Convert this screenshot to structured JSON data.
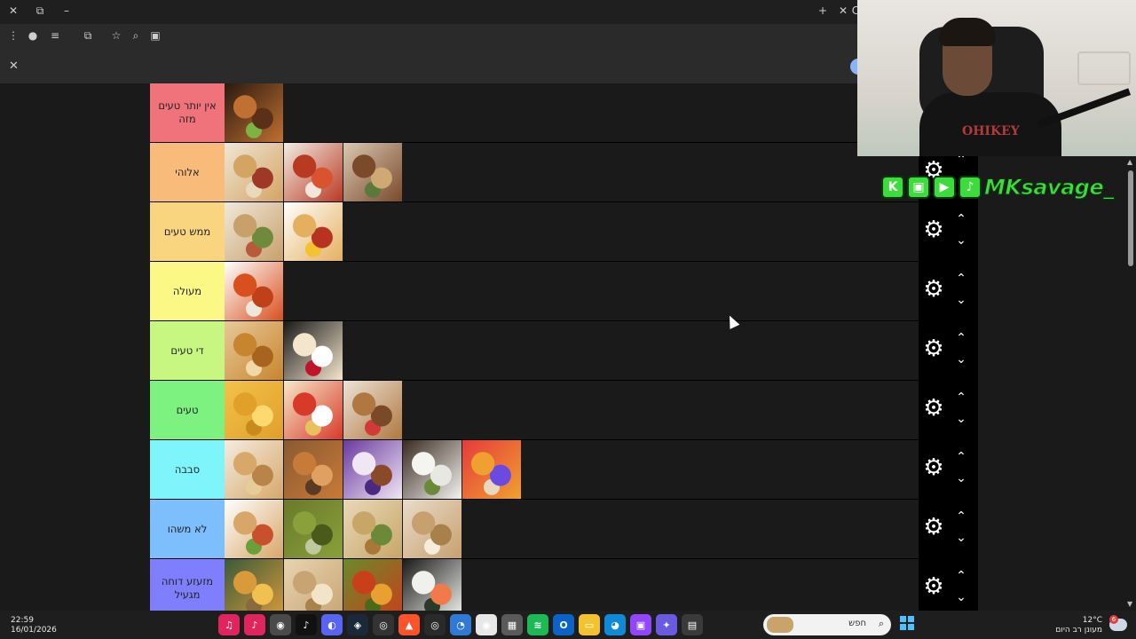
{
  "browser": {
    "titlebar_icons": [
      "close-icon",
      "restore-icon",
      "minimize-icon"
    ],
    "new_tab_label": "+",
    "tab_close_label": "✕",
    "tab_partial_label": "C"
  },
  "toolbar": {
    "icons": [
      "menu-dots-icon",
      "profile-avatar-icon",
      "reading-list-icon",
      "extensions-icon",
      "bookmark-star-icon",
      "zoom-icon",
      "translate-icon"
    ]
  },
  "findbar": {
    "close_label": "✕"
  },
  "tiers": [
    {
      "label": "אין יותר טעים מזה",
      "color": "#f0727b",
      "items": [
        {
          "name": "burger",
          "colors": [
            "#2b1a10",
            "#c07030",
            "#5a3018",
            "#7cb342"
          ]
        }
      ]
    },
    {
      "label": "אלוהי",
      "color": "#f8bb7a",
      "items": [
        {
          "name": "sausage-rolls",
          "colors": [
            "#efe6d6",
            "#d4a462",
            "#a03828",
            "#e8d8bc"
          ]
        },
        {
          "name": "red-pasta",
          "colors": [
            "#f2ece4",
            "#b83a22",
            "#d9542e",
            "#f0e6dc"
          ]
        },
        {
          "name": "pita-sandwich",
          "colors": [
            "#d9c8b2",
            "#7a4a2a",
            "#cfa874",
            "#5a7a3a"
          ]
        }
      ]
    },
    {
      "label": "ממש טעים",
      "color": "#f9d57f",
      "items": [
        {
          "name": "burritos",
          "colors": [
            "#f0e8dc",
            "#c8a06a",
            "#6f8a3a",
            "#b85a3a"
          ]
        },
        {
          "name": "hot-dog",
          "colors": [
            "#ffffff",
            "#e4b060",
            "#b83222",
            "#f2c230"
          ]
        }
      ]
    },
    {
      "label": "מעולה",
      "color": "#fbf886",
      "items": [
        {
          "name": "spaghetti",
          "colors": [
            "#ffffff",
            "#d8501e",
            "#c0401a",
            "#efe7dc"
          ]
        }
      ]
    },
    {
      "label": "די טעים",
      "color": "#c8f781",
      "items": [
        {
          "name": "onion-rings",
          "colors": [
            "#e8c89a",
            "#c7862e",
            "#a8641e",
            "#f0d8a8"
          ]
        },
        {
          "name": "donut",
          "colors": [
            "#1a1a1a",
            "#f4e6cc",
            "#ffffff",
            "#c0142a"
          ]
        }
      ]
    },
    {
      "label": "טעים",
      "color": "#7df281",
      "items": [
        {
          "name": "french-fries",
          "colors": [
            "#f2c24a",
            "#e0a02a",
            "#ffd870",
            "#c88a1a"
          ]
        },
        {
          "name": "popcorn",
          "colors": [
            "#f5e8c8",
            "#d83a2a",
            "#ffffff",
            "#e8c060"
          ]
        },
        {
          "name": "crepes",
          "colors": [
            "#ece3d6",
            "#b07840",
            "#7a4a28",
            "#d23a3a"
          ]
        }
      ]
    },
    {
      "label": "סבבה",
      "color": "#7ef5fa",
      "items": [
        {
          "name": "bourekas",
          "colors": [
            "#f4ece0",
            "#d7a86a",
            "#b88448",
            "#e8cc98"
          ]
        },
        {
          "name": "croissant",
          "colors": [
            "#8a5a32",
            "#c87a38",
            "#e0a060",
            "#5a3a22"
          ]
        },
        {
          "name": "popsicle",
          "colors": [
            "#6a3aa0",
            "#f0e6f4",
            "#8a4a2a",
            "#4a2a80"
          ]
        },
        {
          "name": "rice",
          "colors": [
            "#3a2a20",
            "#f4f4f0",
            "#e8e8e2",
            "#6a8a3a"
          ]
        },
        {
          "name": "rainbow-popsicle",
          "colors": [
            "#e63a3a",
            "#f0a030",
            "#6a4ae0",
            "#e8d8c0"
          ]
        }
      ]
    },
    {
      "label": "לא משהו",
      "color": "#7dbffd",
      "items": [
        {
          "name": "sub-sandwich",
          "colors": [
            "#ffffff",
            "#d8a668",
            "#c8502a",
            "#6aa03a"
          ]
        },
        {
          "name": "pickles",
          "colors": [
            "#6a7a2a",
            "#8aa03a",
            "#4a5a1a",
            "#c0c8a0"
          ]
        },
        {
          "name": "hummus",
          "colors": [
            "#e8d8b8",
            "#c8a668",
            "#6a8a3a",
            "#a87838"
          ]
        },
        {
          "name": "pastry",
          "colors": [
            "#e8dcc8",
            "#c8a070",
            "#a8804a",
            "#f4ecdc"
          ]
        }
      ]
    },
    {
      "label": "מזעזע דוחה מגעיל",
      "color": "#7f7ffd",
      "items": [
        {
          "name": "chickpea-soup",
          "colors": [
            "#3a5a3a",
            "#d89a3a",
            "#f0c050",
            "#8a6a3a"
          ]
        },
        {
          "name": "matzah",
          "colors": [
            "#e8d4b0",
            "#c8a472",
            "#f2e4c8",
            "#a8824a"
          ]
        },
        {
          "name": "olives-salad",
          "colors": [
            "#6a8a2a",
            "#c8401a",
            "#e8a030",
            "#4a6a1a"
          ]
        },
        {
          "name": "sushi",
          "colors": [
            "#1a1a1a",
            "#f0f0ec",
            "#f07a4a",
            "#2a3a2a"
          ]
        }
      ]
    }
  ],
  "controls": {
    "gear_label": "⚙",
    "up_label": "⌃",
    "down_label": "⌄"
  },
  "webcam": {
    "shirt_text": "OHIKEY"
  },
  "social": {
    "handle": "MKsavage_",
    "icons": [
      "kick-icon",
      "twitch-icon",
      "youtube-icon",
      "tiktok-icon"
    ]
  },
  "taskbar": {
    "time": "22:59",
    "date": "16/01/2026",
    "search_placeholder": "חפש",
    "temperature": "12°C",
    "weather_text": "מעונן רב היום",
    "weather_badge": "6",
    "apps": [
      {
        "name": "music-icon",
        "color": "#e0245e",
        "glyph": "♫"
      },
      {
        "name": "tiktok-app-icon",
        "color": "#e0245e",
        "glyph": "♪"
      },
      {
        "name": "chrome-active-icon",
        "color": "#4a4a4a",
        "glyph": "◉"
      },
      {
        "name": "tiktok-icon",
        "color": "#111111",
        "glyph": "♪"
      },
      {
        "name": "discord-icon",
        "color": "#5865f2",
        "glyph": "◐"
      },
      {
        "name": "steam-icon",
        "color": "#1b2838",
        "glyph": "◈"
      },
      {
        "name": "github-icon",
        "color": "#333333",
        "glyph": "◎"
      },
      {
        "name": "brave-icon",
        "color": "#fb542b",
        "glyph": "▲"
      },
      {
        "name": "obs-icon",
        "color": "#2a2a2a",
        "glyph": "◎"
      },
      {
        "name": "edge-dev-icon",
        "color": "#2f7ad6",
        "glyph": "◔"
      },
      {
        "name": "chrome-icon",
        "color": "#e8e8e8",
        "glyph": "◉"
      },
      {
        "name": "store-icon",
        "color": "#5a5a5a",
        "glyph": "▦"
      },
      {
        "name": "spotify-icon",
        "color": "#1db954",
        "glyph": "≋"
      },
      {
        "name": "outlook-icon",
        "color": "#0a64c8",
        "glyph": "O"
      },
      {
        "name": "folder-icon",
        "color": "#f2c230",
        "glyph": "▭"
      },
      {
        "name": "edge-icon",
        "color": "#0f8ad8",
        "glyph": "◕"
      },
      {
        "name": "twitch-app-icon",
        "color": "#9146ff",
        "glyph": "▣"
      },
      {
        "name": "copilot-icon",
        "color": "#6a5ae0",
        "glyph": "✦"
      },
      {
        "name": "snip-icon",
        "color": "#3a3a3a",
        "glyph": "▤"
      }
    ]
  }
}
